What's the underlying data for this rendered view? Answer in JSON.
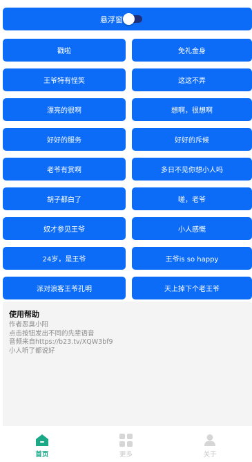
{
  "float_switch": {
    "label": "悬浮窗",
    "enabled": true
  },
  "buttons": [
    [
      "戳啦",
      "免礼金身"
    ],
    [
      "王爷特有怪笑",
      "这这不弄"
    ],
    [
      "漂亮的很啊",
      "想啊，很想啊"
    ],
    [
      "好好的服务",
      "好好的斥候"
    ],
    [
      "老爷有赏啊",
      "多日不见你想小人吗"
    ],
    [
      "胡子都白了",
      "嗟，老爷"
    ],
    [
      "奴才参见王爷",
      "小人感慨"
    ],
    [
      "24岁，是王爷",
      "王爷is so happy"
    ],
    [
      "派对浪客王爷孔明",
      "天上掉下个老王爷"
    ]
  ],
  "help": {
    "title": "使用帮助",
    "lines": [
      "作者恶臭小阳",
      "点击按钮发出不同的先辈语音",
      "音频来自https://b23.tv/XQW3bf9",
      "小人听了都说好"
    ]
  },
  "tabs": [
    {
      "label": "首页",
      "icon": "home-icon",
      "active": true
    },
    {
      "label": "更多",
      "icon": "grid-icon",
      "active": false
    },
    {
      "label": "关于",
      "icon": "user-icon",
      "active": false
    }
  ],
  "colors": {
    "accent": "#0c6cf7",
    "active_tab": "#1aa886",
    "inactive_tab": "#c8c8c8",
    "help_bg": "#f4f4f4"
  }
}
